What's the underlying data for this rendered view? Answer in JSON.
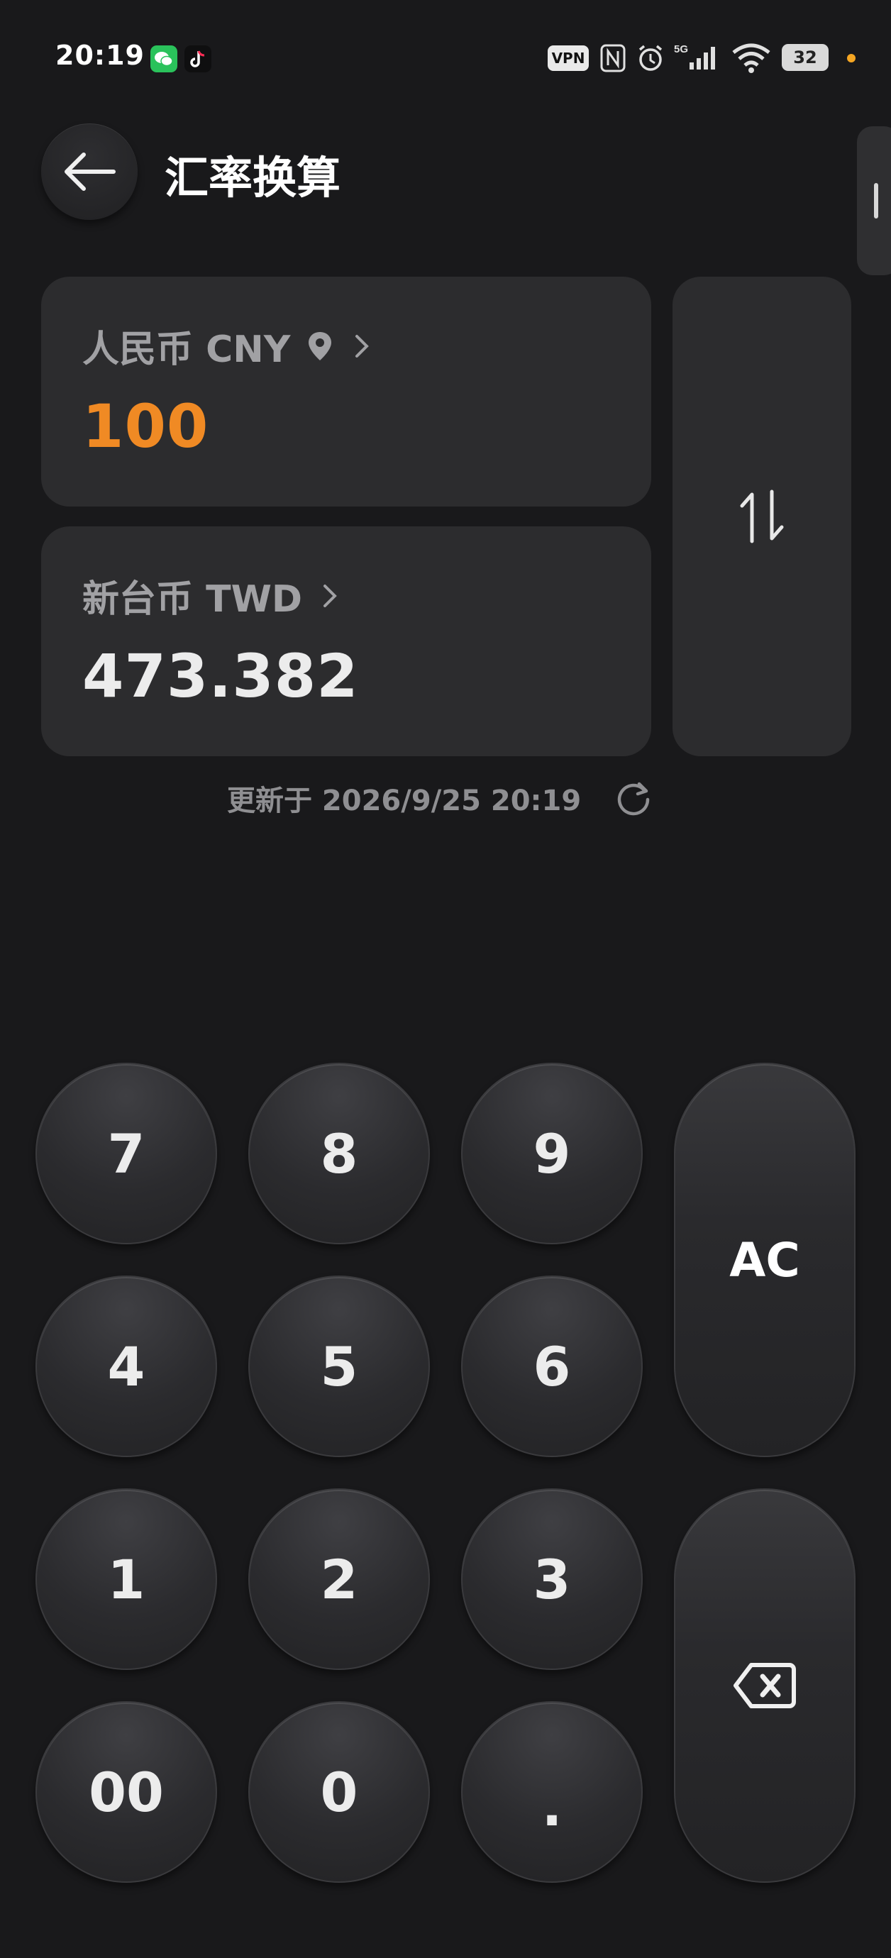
{
  "status": {
    "time": "20:19",
    "vpn": "VPN",
    "network": "5G",
    "battery": "32"
  },
  "header": {
    "title": "汇率换算"
  },
  "from_currency": {
    "name": "人民币 CNY",
    "value": "100",
    "accent": "#f08a24"
  },
  "to_currency": {
    "name": "新台币 TWD",
    "value": "473.382"
  },
  "updated": {
    "text": "更新于 2026/9/25 20:19"
  },
  "keypad": {
    "k7": "7",
    "k8": "8",
    "k9": "9",
    "k4": "4",
    "k5": "5",
    "k6": "6",
    "k1": "1",
    "k2": "2",
    "k3": "3",
    "k00": "00",
    "k0": "0",
    "kdot": ".",
    "clear": "AC"
  }
}
